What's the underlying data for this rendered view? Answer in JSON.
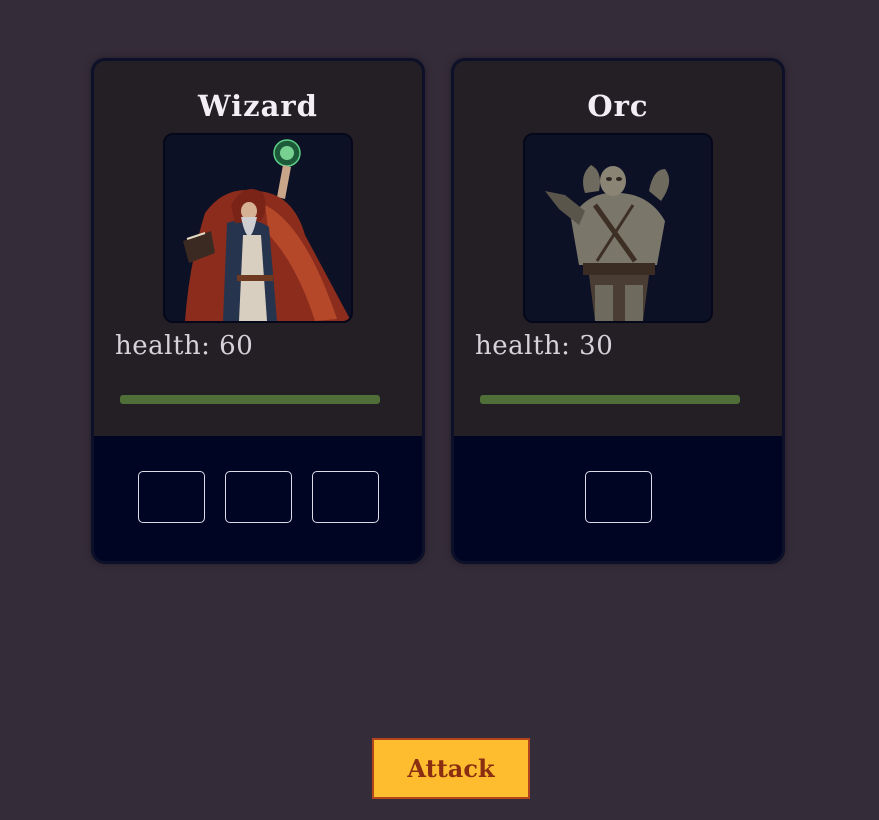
{
  "characters": [
    {
      "name": "Wizard",
      "health_label": "health: 60",
      "health_fraction": 1.0,
      "slots": 3,
      "portrait": "wizard-figure"
    },
    {
      "name": "Orc",
      "health_label": "health: 30",
      "health_fraction": 1.0,
      "slots": 1,
      "portrait": "orc-figure"
    }
  ],
  "attack_button": {
    "label": "Attack"
  },
  "colors": {
    "background": "#352c3a",
    "card": "#231f24",
    "card_footer": "#010524",
    "health_bar": "#4f6e38",
    "button": "#fdbd2e",
    "button_text": "#8a2e12"
  }
}
